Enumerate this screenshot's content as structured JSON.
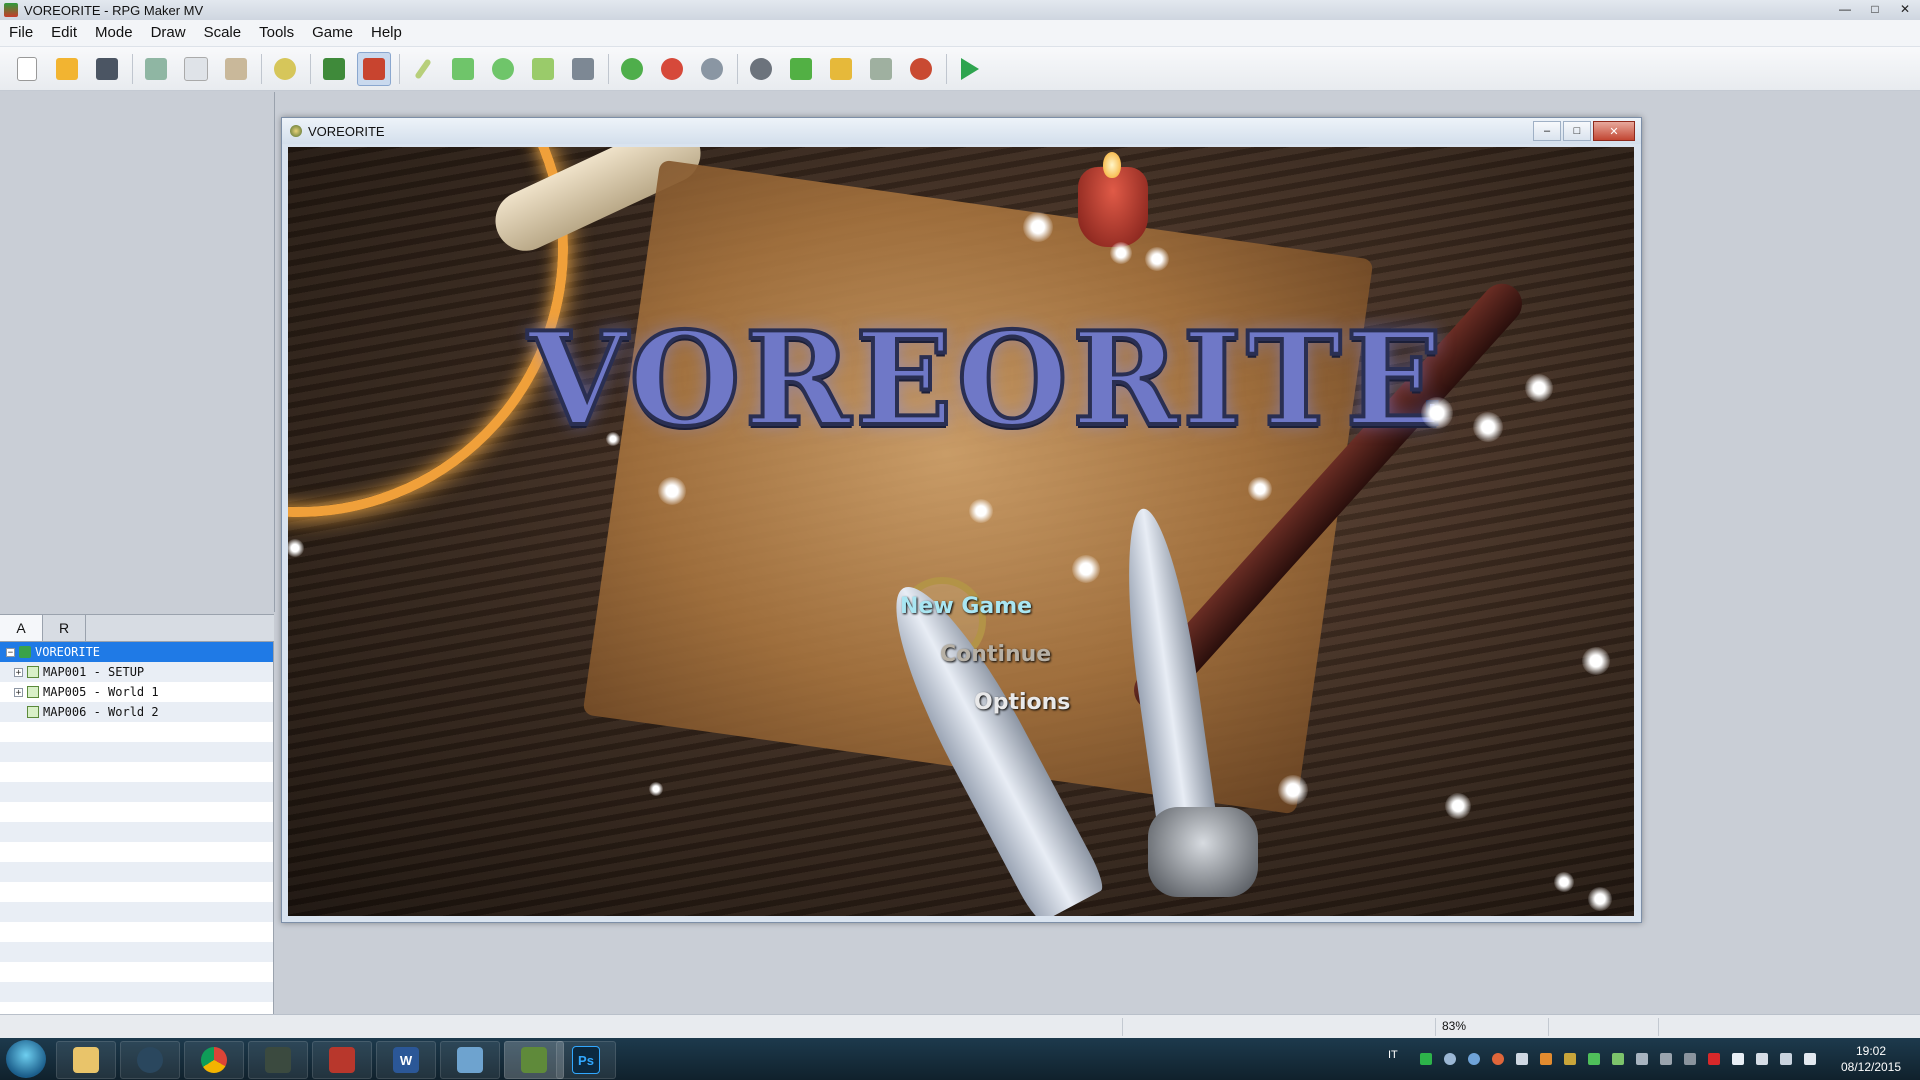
{
  "window": {
    "title": "VOREORITE - RPG Maker MV"
  },
  "menu": [
    "File",
    "Edit",
    "Mode",
    "Draw",
    "Scale",
    "Tools",
    "Game",
    "Help"
  ],
  "toolbar": {
    "icons": [
      "new-project-icon",
      "open-project-icon",
      "save-project-icon",
      "cut-icon",
      "copy-icon",
      "paste-icon",
      "undo-icon",
      "map-mode-icon",
      "event-mode-icon",
      "pencil-icon",
      "rectangle-icon",
      "ellipse-icon",
      "fill-icon",
      "shadow-pen-icon",
      "zoom-in-icon",
      "zoom-out-icon",
      "actual-size-icon",
      "database-icon",
      "plugin-manager-icon",
      "sound-test-icon",
      "event-searcher-icon",
      "character-generator-icon",
      "playtest-icon"
    ],
    "active": "event-mode-icon"
  },
  "tabs": [
    "A",
    "R"
  ],
  "map_tree": [
    {
      "label": "VOREORITE",
      "type": "project",
      "selected": true,
      "expander": "−"
    },
    {
      "label": "MAP001 - SETUP",
      "type": "map",
      "expander": "+"
    },
    {
      "label": "MAP005 - World 1",
      "type": "map",
      "expander": "+"
    },
    {
      "label": "MAP006 - World 2",
      "type": "map",
      "expander": ""
    }
  ],
  "game": {
    "window_title": "VOREORITE",
    "logo": "VOREORITE",
    "commands": {
      "new_game": "New Game",
      "continue": "Continue",
      "options": "Options"
    }
  },
  "status": {
    "zoom": "83%"
  },
  "taskbar": {
    "apps": [
      "file-explorer-icon",
      "steam-icon",
      "chrome-icon",
      "terminal-icon",
      "castle-app-icon",
      "word-icon",
      "photo-viewer-icon",
      "rpg-maker-icon",
      "photoshop-icon"
    ],
    "photoshop_label": "Ps",
    "word_label": "W",
    "language": "IT",
    "time": "19:02",
    "date": "08/12/2015"
  },
  "colors": {
    "selection": "#1f7ae6",
    "new_game": "#a9e6f2",
    "continue": "#b7b1a6",
    "options": "#e9e9ea"
  }
}
